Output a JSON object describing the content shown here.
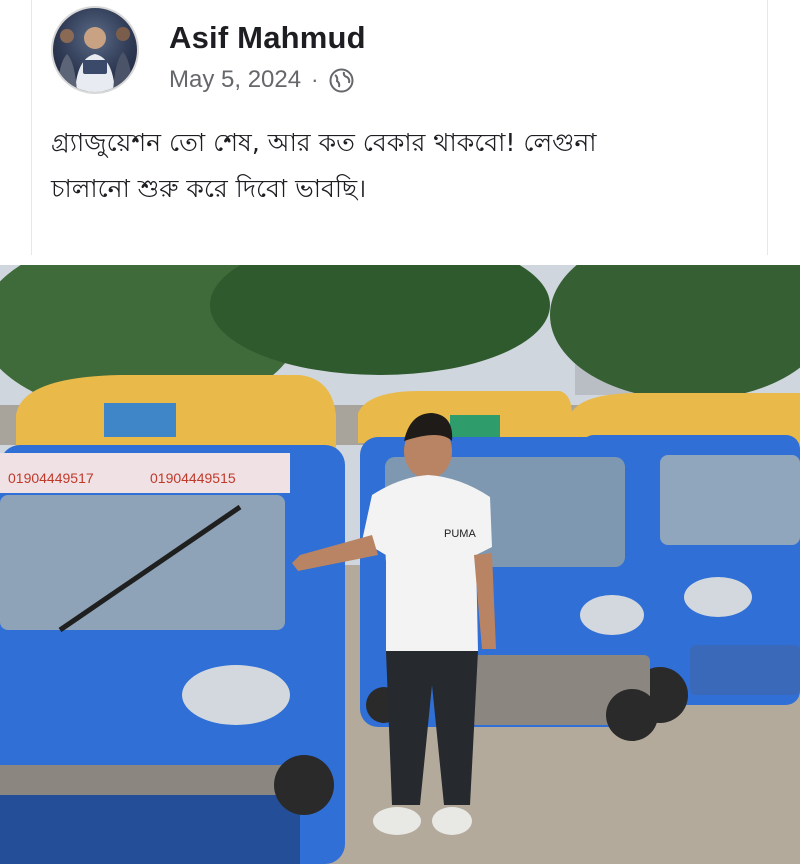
{
  "post": {
    "author_name": "Asif Mahmud",
    "date": "May 5, 2024",
    "separator": "·",
    "audience_icon": "globe-icon",
    "text_line1": "গ্র্যাজুয়েশন তো শেষ, আর কত বেকার থাকবো! লেগুনা",
    "text_line2": "চালানো শুরু করে দিবো ভাবছি।"
  },
  "photo": {
    "description_icon": "post-photo",
    "vehicle_sign_1": "01904449517",
    "vehicle_sign_2": "01904449515",
    "shirt_logo": "PUMA"
  },
  "colors": {
    "text": "#1c1e21",
    "secondary_text": "#65676b",
    "vehicle_blue": "#2f6fd6",
    "vehicle_roof": "#e9b949"
  }
}
